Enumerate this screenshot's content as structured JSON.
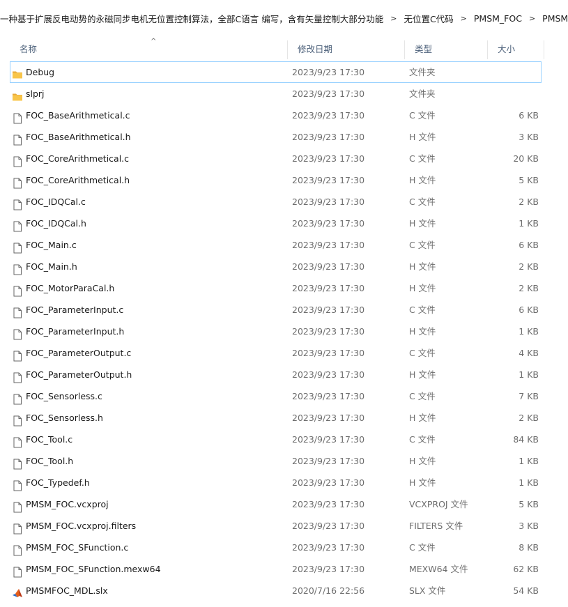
{
  "breadcrumb": [
    "一种基于扩展反电动势的永磁同步电机无位置控制算法，全部C语言 编写，含有矢量控制大部分功能",
    "无位置C代码",
    "PMSM_FOC",
    "PMSM_FOC"
  ],
  "columns": {
    "name": "名称",
    "date": "修改日期",
    "type": "类型",
    "size": "大小"
  },
  "files": [
    {
      "name": "Debug",
      "date": "2023/9/23 17:30",
      "type": "文件夹",
      "size": "",
      "icon": "folder-icon",
      "selected": true
    },
    {
      "name": "slprj",
      "date": "2023/9/23 17:30",
      "type": "文件夹",
      "size": "",
      "icon": "folder-icon"
    },
    {
      "name": "FOC_BaseArithmetical.c",
      "date": "2023/9/23 17:30",
      "type": "C 文件",
      "size": "6 KB",
      "icon": "file-icon"
    },
    {
      "name": "FOC_BaseArithmetical.h",
      "date": "2023/9/23 17:30",
      "type": "H 文件",
      "size": "3 KB",
      "icon": "file-icon"
    },
    {
      "name": "FOC_CoreArithmetical.c",
      "date": "2023/9/23 17:30",
      "type": "C 文件",
      "size": "20 KB",
      "icon": "file-icon"
    },
    {
      "name": "FOC_CoreArithmetical.h",
      "date": "2023/9/23 17:30",
      "type": "H 文件",
      "size": "5 KB",
      "icon": "file-icon"
    },
    {
      "name": "FOC_IDQCal.c",
      "date": "2023/9/23 17:30",
      "type": "C 文件",
      "size": "2 KB",
      "icon": "file-icon"
    },
    {
      "name": "FOC_IDQCal.h",
      "date": "2023/9/23 17:30",
      "type": "H 文件",
      "size": "1 KB",
      "icon": "file-icon"
    },
    {
      "name": "FOC_Main.c",
      "date": "2023/9/23 17:30",
      "type": "C 文件",
      "size": "6 KB",
      "icon": "file-icon"
    },
    {
      "name": "FOC_Main.h",
      "date": "2023/9/23 17:30",
      "type": "H 文件",
      "size": "2 KB",
      "icon": "file-icon"
    },
    {
      "name": "FOC_MotorParaCal.h",
      "date": "2023/9/23 17:30",
      "type": "H 文件",
      "size": "2 KB",
      "icon": "file-icon"
    },
    {
      "name": "FOC_ParameterInput.c",
      "date": "2023/9/23 17:30",
      "type": "C 文件",
      "size": "6 KB",
      "icon": "file-icon"
    },
    {
      "name": "FOC_ParameterInput.h",
      "date": "2023/9/23 17:30",
      "type": "H 文件",
      "size": "1 KB",
      "icon": "file-icon"
    },
    {
      "name": "FOC_ParameterOutput.c",
      "date": "2023/9/23 17:30",
      "type": "C 文件",
      "size": "4 KB",
      "icon": "file-icon"
    },
    {
      "name": "FOC_ParameterOutput.h",
      "date": "2023/9/23 17:30",
      "type": "H 文件",
      "size": "1 KB",
      "icon": "file-icon"
    },
    {
      "name": "FOC_Sensorless.c",
      "date": "2023/9/23 17:30",
      "type": "C 文件",
      "size": "7 KB",
      "icon": "file-icon"
    },
    {
      "name": "FOC_Sensorless.h",
      "date": "2023/9/23 17:30",
      "type": "H 文件",
      "size": "2 KB",
      "icon": "file-icon"
    },
    {
      "name": "FOC_Tool.c",
      "date": "2023/9/23 17:30",
      "type": "C 文件",
      "size": "84 KB",
      "icon": "file-icon"
    },
    {
      "name": "FOC_Tool.h",
      "date": "2023/9/23 17:30",
      "type": "H 文件",
      "size": "1 KB",
      "icon": "file-icon"
    },
    {
      "name": "FOC_Typedef.h",
      "date": "2023/9/23 17:30",
      "type": "H 文件",
      "size": "1 KB",
      "icon": "file-icon"
    },
    {
      "name": "PMSM_FOC.vcxproj",
      "date": "2023/9/23 17:30",
      "type": "VCXPROJ 文件",
      "size": "5 KB",
      "icon": "file-icon"
    },
    {
      "name": "PMSM_FOC.vcxproj.filters",
      "date": "2023/9/23 17:30",
      "type": "FILTERS 文件",
      "size": "3 KB",
      "icon": "file-icon"
    },
    {
      "name": "PMSM_FOC_SFunction.c",
      "date": "2023/9/23 17:30",
      "type": "C 文件",
      "size": "8 KB",
      "icon": "file-icon"
    },
    {
      "name": "PMSM_FOC_SFunction.mexw64",
      "date": "2023/9/23 17:30",
      "type": "MEXW64 文件",
      "size": "62 KB",
      "icon": "file-icon"
    },
    {
      "name": "PMSMFOC_MDL.slx",
      "date": "2020/7/16 22:56",
      "type": "SLX 文件",
      "size": "54 KB",
      "icon": "matlab-icon"
    }
  ],
  "colors": {
    "selection_border": "#99d1ff",
    "header_text": "#4c607a",
    "folder": "#f8c54a",
    "folder_dark": "#e8a93a"
  }
}
